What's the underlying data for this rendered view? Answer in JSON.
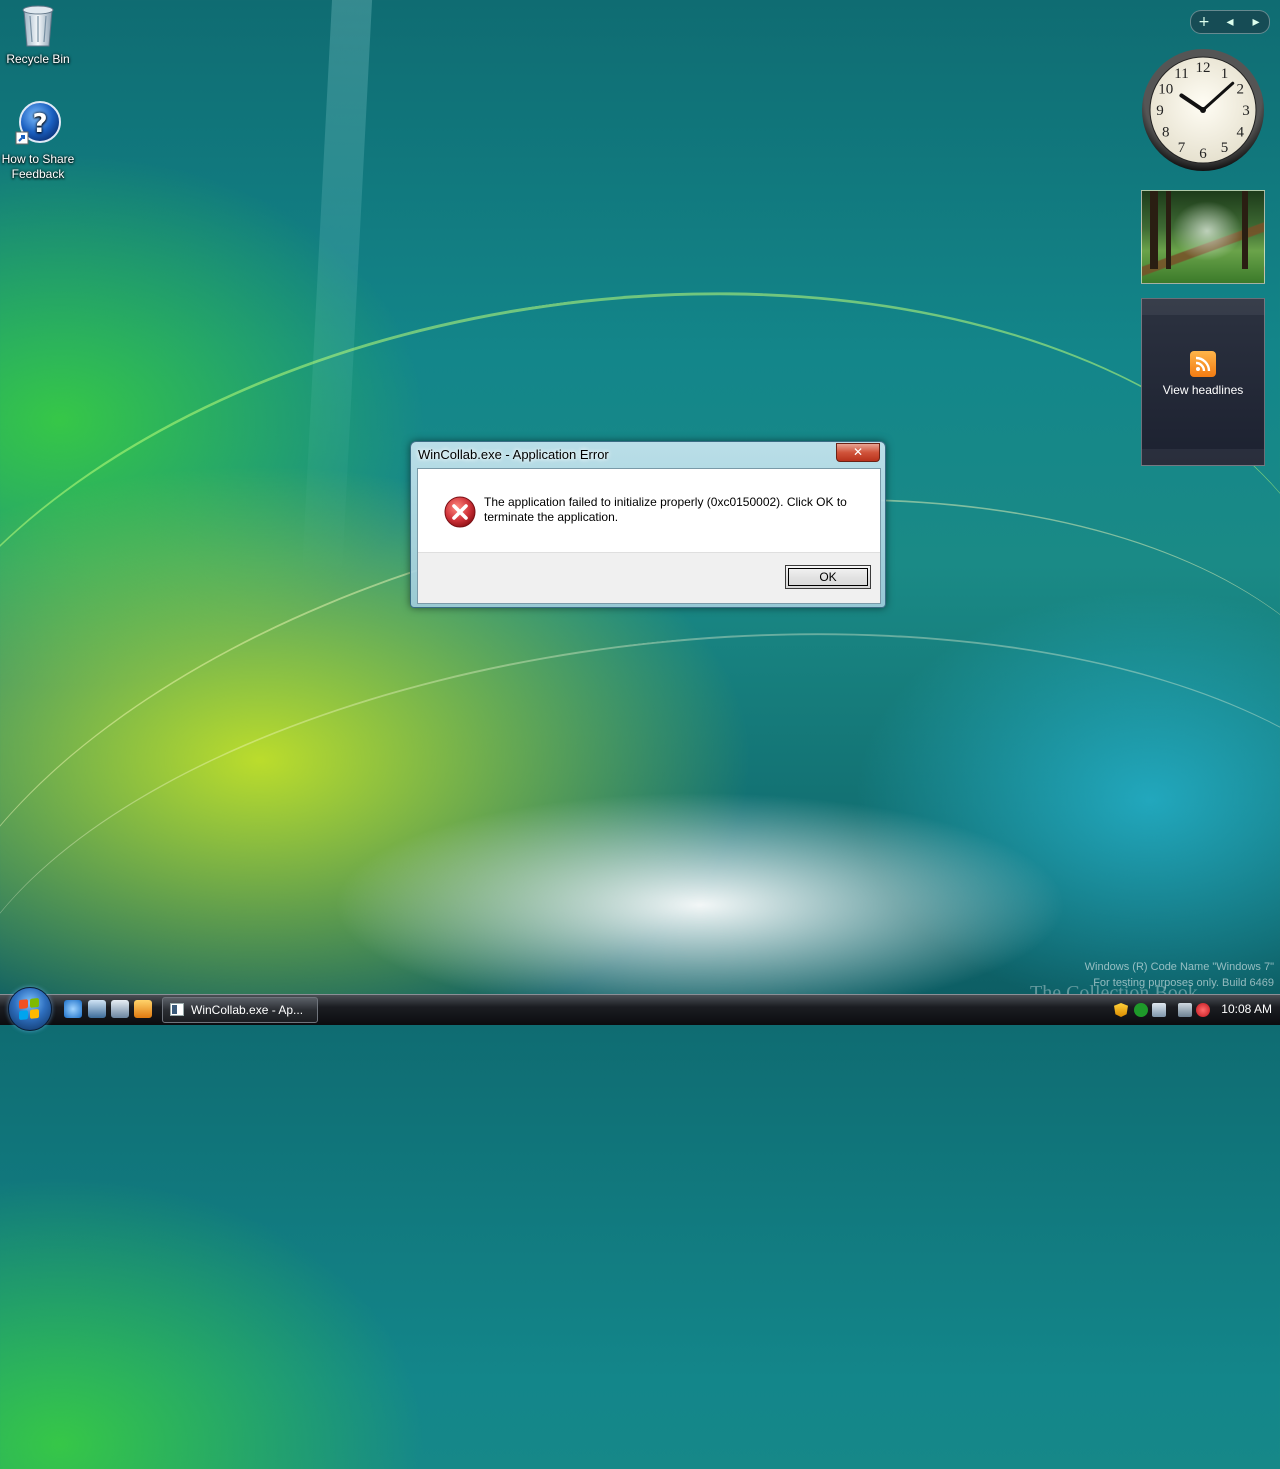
{
  "desktop": {
    "icons": [
      {
        "label": "Recycle Bin"
      },
      {
        "label": "How to Share Feedback"
      }
    ]
  },
  "gadgets": {
    "clock": {
      "numerals": [
        "12",
        "1",
        "2",
        "3",
        "4",
        "5",
        "6",
        "7",
        "8",
        "9",
        "10",
        "11"
      ],
      "hour": 10,
      "minute": 8
    },
    "feed": {
      "label": "View headlines"
    },
    "toolbar": {
      "add": "+",
      "prev": "◂",
      "next": "▸"
    }
  },
  "dialog": {
    "title": "WinCollab.exe - Application Error",
    "close_label": "✕",
    "message": "The application failed to initialize properly (0xc0150002). Click OK to terminate the application.",
    "ok_label": "OK",
    "icon": "error-icon"
  },
  "watermark": {
    "line1": "Windows (R) Code Name \"Windows 7\"",
    "line2": "For testing purposes only. Build 6469",
    "brand": "The Collection Book"
  },
  "taskbar": {
    "task_label": "WinCollab.exe - Ap...",
    "time": "10:08 AM",
    "quick_launch": [
      "internet-explorer-icon",
      "show-desktop-icon",
      "switch-windows-icon",
      "media-player-icon"
    ]
  },
  "colors": {
    "accent": "#2e6fbf",
    "error_red": "#d0333a"
  }
}
